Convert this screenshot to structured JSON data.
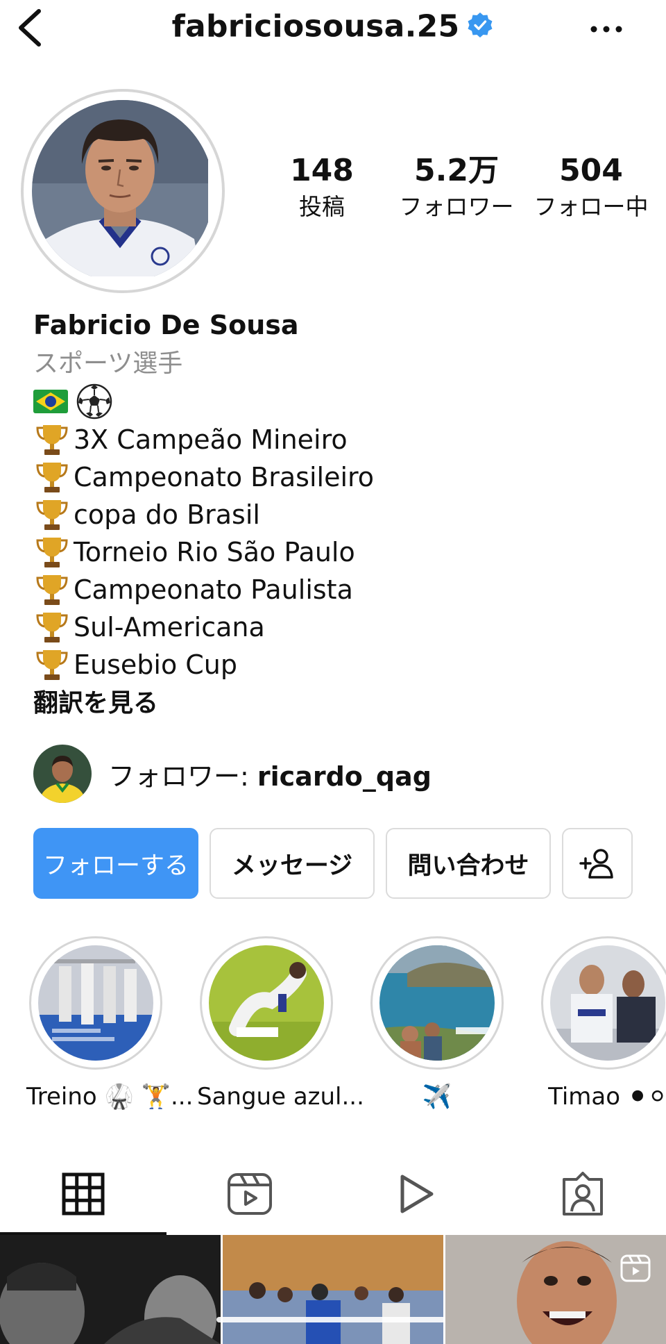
{
  "header": {
    "username": "fabriciosousa.25"
  },
  "stats": [
    {
      "value": "148",
      "label": "投稿"
    },
    {
      "value": "5.2万",
      "label": "フォロワー"
    },
    {
      "value": "504",
      "label": "フォロー中"
    }
  ],
  "bio": {
    "full_name": "Fabricio De Sousa",
    "category": "スポーツ選手",
    "flag_line": "🇧🇷 ⚽",
    "lines": [
      "3X Campeão Mineiro",
      "Campeonato Brasileiro",
      "copa do Brasil",
      "Torneio Rio São Paulo",
      "Campeonato Paulista",
      "Sul-Americana",
      "Eusebio Cup"
    ],
    "translate_label": "翻訳を見る"
  },
  "followed_by": {
    "prefix": "フォロワー: ",
    "username": "ricardo_qag"
  },
  "buttons": {
    "follow": "フォローする",
    "message": "メッセージ",
    "contact": "問い合わせ"
  },
  "highlights": [
    {
      "label": "Treino 🥋 🏋..."
    },
    {
      "label": "Sangue azul..."
    },
    {
      "label": "✈️"
    },
    {
      "label": "Timao ⚫⚪"
    }
  ],
  "colors": {
    "accent": "#3f95f5",
    "verified": "#3897f0",
    "muted": "#8e8e8e",
    "border": "#dbdbdb"
  },
  "icons": {
    "back": "chevron-left-icon",
    "more": "more-horizontal-icon",
    "verified": "verified-badge-icon",
    "add_user": "add-user-icon",
    "tab_grid": "grid-icon",
    "tab_reels": "reels-icon",
    "tab_video": "play-icon",
    "tab_tagged": "tagged-user-icon"
  }
}
